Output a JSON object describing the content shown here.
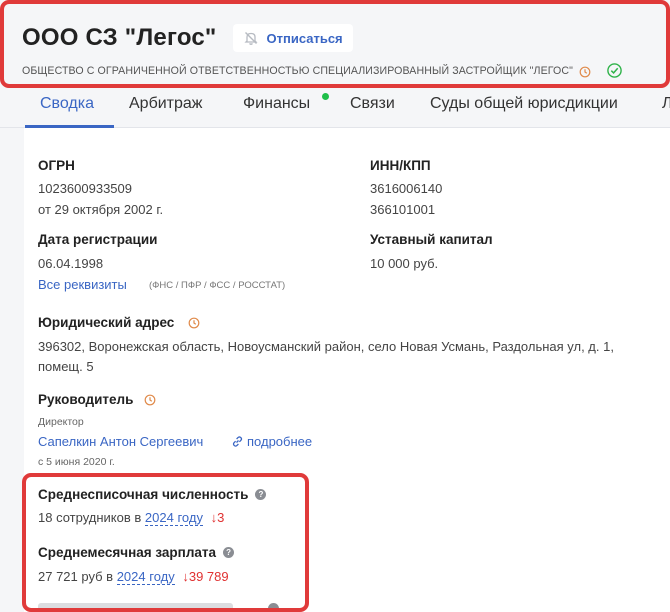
{
  "header": {
    "title": "ООО СЗ \"Легос\"",
    "unsubscribe_label": "Отписаться",
    "full_name": "ОБЩЕСТВО С ОГРАНИЧЕННОЙ ОТВЕТСТВЕННОСТЬЮ СПЕЦИАЛИЗИРОВАННЫЙ ЗАСТРОЙЩИК \"ЛЕГОС\""
  },
  "tabs": [
    {
      "label": "Сводка",
      "active": true
    },
    {
      "label": "Арбитраж"
    },
    {
      "label": "Финансы",
      "has_new_dot": true
    },
    {
      "label": "Связи"
    },
    {
      "label": "Суды общей юрисдикции"
    },
    {
      "label": "Л"
    }
  ],
  "ogrn": {
    "label": "ОГРН",
    "value": "1023600933509",
    "date": "от 29 октября 2002 г."
  },
  "inn_kpp": {
    "label": "ИНН/КПП",
    "inn": "3616006140",
    "kpp": "366101001"
  },
  "registration": {
    "label": "Дата регистрации",
    "value": "06.04.1998"
  },
  "capital": {
    "label": "Уставный капитал",
    "value": "10 000 руб."
  },
  "requisites": {
    "link": "Все реквизиты",
    "note": "(ФНС / ПФР / ФСС / РОССТАТ)"
  },
  "address": {
    "label": "Юридический адрес",
    "line1": "396302, Воронежская область, Новоусманский район, село Новая Усмань, Раздольная ул, д. 1,",
    "line2": "помещ. 5"
  },
  "director": {
    "label": "Руководитель",
    "role": "Директор",
    "name": "Сапелкин Антон Сергеевич",
    "more_link": "подробнее",
    "since": "с 5 июня 2020 г."
  },
  "headcount": {
    "label": "Среднесписочная численность",
    "value_prefix": "18 сотрудников в",
    "year": "2024 году",
    "change": "↓3"
  },
  "salary": {
    "label": "Среднемесячная зарплата",
    "value_prefix": "27 721 руб в",
    "year": "2024 году",
    "change": "↓39 789"
  },
  "colors": {
    "accent": "#3a66c4",
    "highlight": "#e03a3a",
    "decrease": "#e03131",
    "new_dot": "#1fbf4a"
  }
}
